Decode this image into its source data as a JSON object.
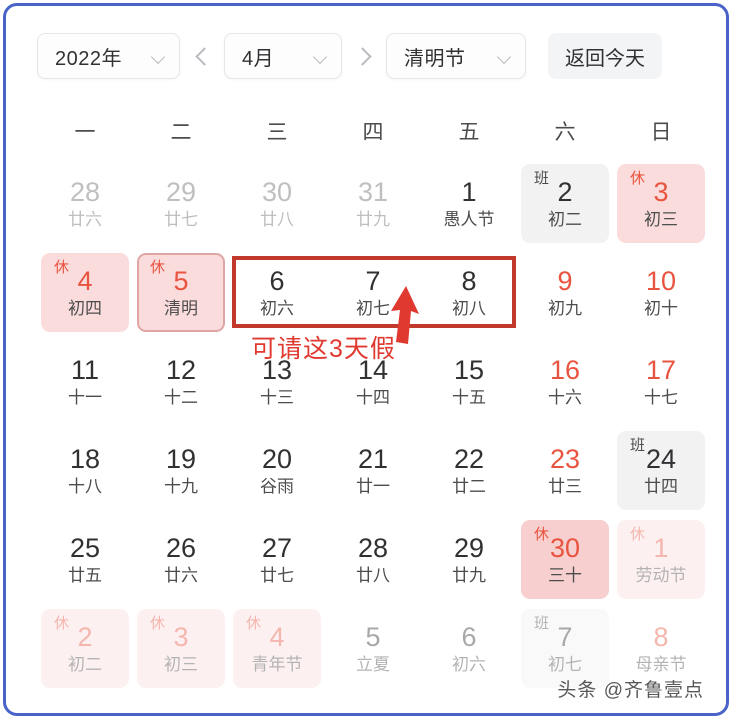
{
  "toolbar": {
    "year": "2022年",
    "month": "4月",
    "festival": "清明节",
    "today_label": "返回今天",
    "prev_icon": "chevron-left-icon",
    "next_icon": "chevron-right-icon"
  },
  "weekdays": [
    "一",
    "二",
    "三",
    "四",
    "五",
    "六",
    "日"
  ],
  "annotation": {
    "text": "可请这3天假",
    "color": "#e03a30",
    "rect_color": "#c0392b"
  },
  "watermark": "头条 @齐鲁壹点",
  "colors": {
    "frame": "#4a63c8",
    "rest_bg": "#fbdcdc",
    "work_bg": "#f2f2f2",
    "red": "#e8543f",
    "text": "#303133"
  },
  "weeks": [
    [
      {
        "day": "28",
        "lunar": "廿六",
        "state": "muted"
      },
      {
        "day": "29",
        "lunar": "廿七",
        "state": "muted"
      },
      {
        "day": "30",
        "lunar": "廿八",
        "state": "muted"
      },
      {
        "day": "31",
        "lunar": "廿九",
        "state": "muted"
      },
      {
        "day": "1",
        "lunar": "愚人节",
        "state": "normal"
      },
      {
        "day": "2",
        "lunar": "初二",
        "state": "work",
        "badge": "班"
      },
      {
        "day": "3",
        "lunar": "初三",
        "state": "rest",
        "badge": "休"
      }
    ],
    [
      {
        "day": "4",
        "lunar": "初四",
        "state": "rest",
        "badge": "休"
      },
      {
        "day": "5",
        "lunar": "清明",
        "state": "rest-selected",
        "badge": "休"
      },
      {
        "day": "6",
        "lunar": "初六",
        "state": "normal"
      },
      {
        "day": "7",
        "lunar": "初七",
        "state": "normal"
      },
      {
        "day": "8",
        "lunar": "初八",
        "state": "normal"
      },
      {
        "day": "9",
        "lunar": "初九",
        "state": "weekend"
      },
      {
        "day": "10",
        "lunar": "初十",
        "state": "weekend"
      }
    ],
    [
      {
        "day": "11",
        "lunar": "十一",
        "state": "normal"
      },
      {
        "day": "12",
        "lunar": "十二",
        "state": "normal"
      },
      {
        "day": "13",
        "lunar": "十三",
        "state": "normal"
      },
      {
        "day": "14",
        "lunar": "十四",
        "state": "normal"
      },
      {
        "day": "15",
        "lunar": "十五",
        "state": "normal"
      },
      {
        "day": "16",
        "lunar": "十六",
        "state": "weekend"
      },
      {
        "day": "17",
        "lunar": "十七",
        "state": "weekend"
      }
    ],
    [
      {
        "day": "18",
        "lunar": "十八",
        "state": "normal"
      },
      {
        "day": "19",
        "lunar": "十九",
        "state": "normal"
      },
      {
        "day": "20",
        "lunar": "谷雨",
        "state": "normal"
      },
      {
        "day": "21",
        "lunar": "廿一",
        "state": "normal"
      },
      {
        "day": "22",
        "lunar": "廿二",
        "state": "normal"
      },
      {
        "day": "23",
        "lunar": "廿三",
        "state": "weekend"
      },
      {
        "day": "24",
        "lunar": "廿四",
        "state": "work",
        "badge": "班"
      }
    ],
    [
      {
        "day": "25",
        "lunar": "廿五",
        "state": "normal"
      },
      {
        "day": "26",
        "lunar": "廿六",
        "state": "normal"
      },
      {
        "day": "27",
        "lunar": "廿七",
        "state": "normal"
      },
      {
        "day": "28",
        "lunar": "廿八",
        "state": "normal"
      },
      {
        "day": "29",
        "lunar": "廿九",
        "state": "normal"
      },
      {
        "day": "30",
        "lunar": "三十",
        "state": "rest-strong",
        "badge": "休"
      },
      {
        "day": "1",
        "lunar": "劳动节",
        "state": "rest-faded",
        "badge": "休"
      }
    ],
    [
      {
        "day": "2",
        "lunar": "初二",
        "state": "rest-faded",
        "badge": "休"
      },
      {
        "day": "3",
        "lunar": "初三",
        "state": "rest-faded",
        "badge": "休"
      },
      {
        "day": "4",
        "lunar": "青年节",
        "state": "rest-faded",
        "badge": "休"
      },
      {
        "day": "5",
        "lunar": "立夏",
        "state": "faded"
      },
      {
        "day": "6",
        "lunar": "初六",
        "state": "faded"
      },
      {
        "day": "7",
        "lunar": "初七",
        "state": "work-faded",
        "badge": "班"
      },
      {
        "day": "8",
        "lunar": "母亲节",
        "state": "rest-num-faded"
      }
    ]
  ]
}
